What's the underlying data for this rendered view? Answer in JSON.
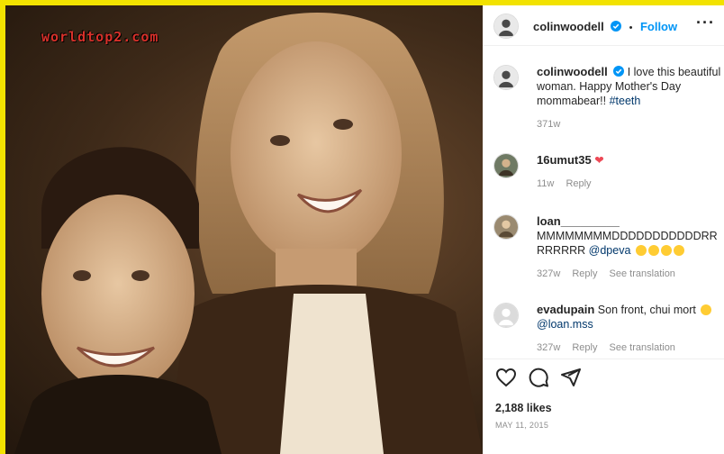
{
  "watermark": "worldtop2.com",
  "post": {
    "username": "colinwoodell",
    "separator": "•",
    "follow_label": "Follow",
    "caption_user": "colinwoodell",
    "caption_text": "I love this beautiful woman. Happy Mother's Day mommabear!!",
    "caption_hashtag": "#teeth",
    "caption_time": "371w",
    "likes": "2,188 likes",
    "date": "MAY 11, 2015"
  },
  "comments": [
    {
      "user": "16umut35",
      "text": "",
      "time": "11w",
      "reply": "Reply",
      "see_translation": ""
    },
    {
      "user": "loan_________",
      "text": "MMMMMMMMDDDDDDDDDDDRRRRRRRR",
      "mention": "@dpeva",
      "time": "327w",
      "reply": "Reply",
      "see_translation": "See translation"
    },
    {
      "user": "evadupain",
      "text": "Son front, chui mort",
      "mention": "@loan.mss",
      "time": "327w",
      "reply": "Reply",
      "see_translation": "See translation"
    }
  ],
  "icons": {
    "heart": "heart-icon",
    "comment": "comment-icon",
    "share": "share-icon",
    "more": "more-icon",
    "verified": "verified-badge-icon"
  },
  "colors": {
    "link": "#0095f6",
    "muted": "#8e8e8e",
    "frame": "#f2e200",
    "like_heart": "#ed4956"
  }
}
